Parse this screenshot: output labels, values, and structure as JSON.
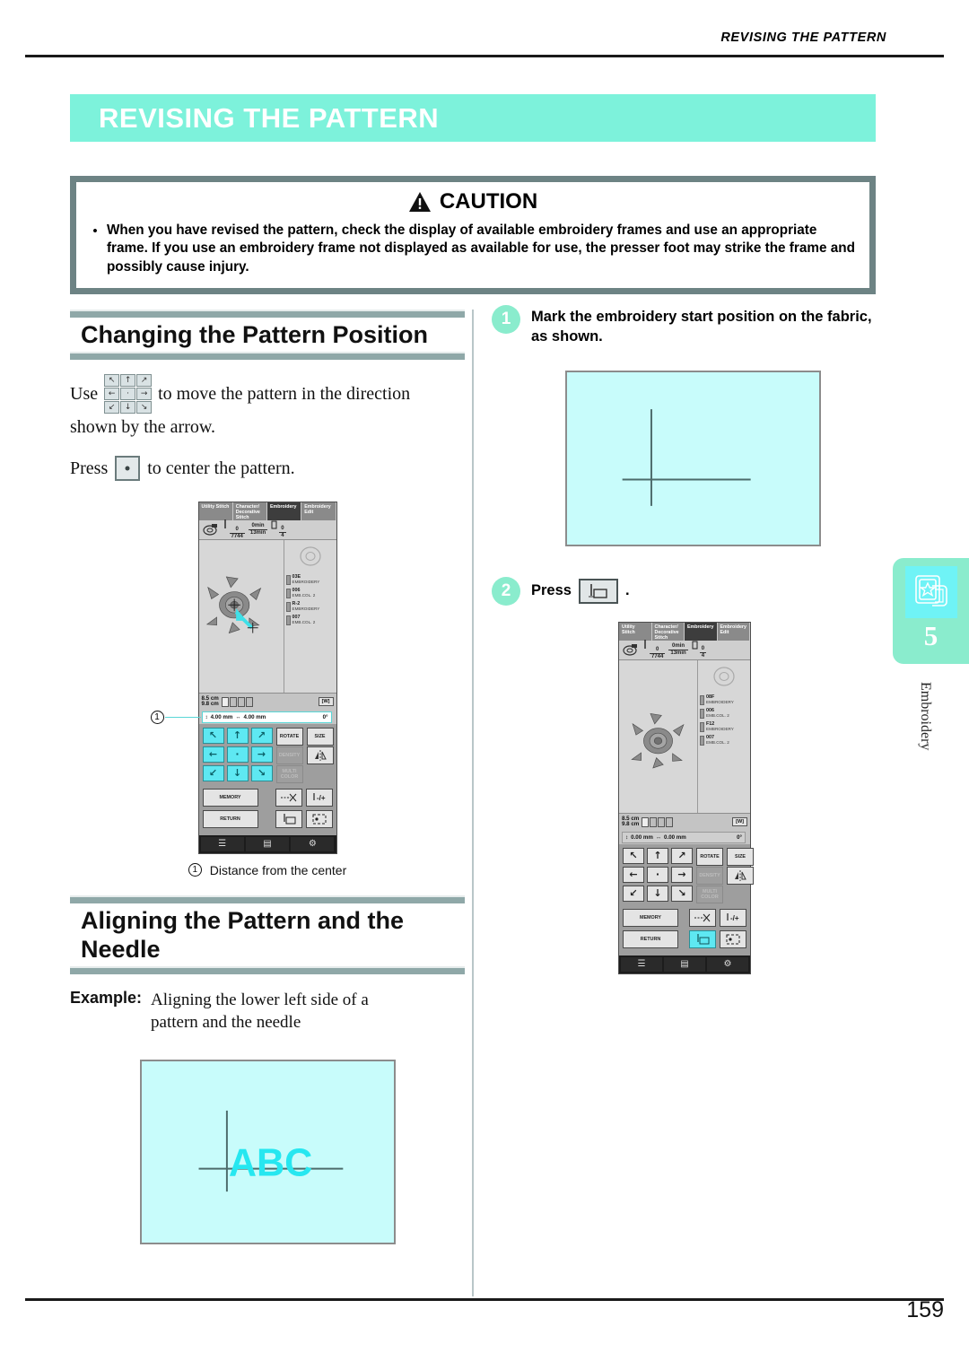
{
  "running_head": "REVISING THE PATTERN",
  "chapter_title": "REVISING THE PATTERN",
  "caution": {
    "heading": "CAUTION",
    "bullet": "•",
    "text": "When you have revised the pattern, check the display of available embroidery frames and use an appropriate frame. If you use an embroidery frame not displayed as available for use, the presser foot may strike the frame and possibly cause injury."
  },
  "left_column": {
    "section1_title": "Changing the Pattern Position",
    "use_prefix": "Use",
    "use_suffix": "to move the pattern in the direction",
    "use_line2": "shown by the arrow.",
    "press_prefix": "Press",
    "press_suffix": "to center the pattern.",
    "caption_number": "1",
    "caption_text": "Distance from the center",
    "section2_title_line1": "Aligning the Pattern and the",
    "section2_title_line2": "Needle",
    "example_label": "Example:",
    "example_text_line1": "Aligning the lower left side of a",
    "example_text_line2": "pattern and the needle",
    "abc_text": "ABC"
  },
  "right_column": {
    "step1_number": "1",
    "step1_text": "Mark the embroidery start position on the fabric, as shown.",
    "step2_number": "2",
    "step2_prefix": "Press",
    "step2_suffix": "."
  },
  "lcd_left": {
    "tabs": [
      {
        "label": "Utility Stitch",
        "active": false
      },
      {
        "label": "Character/ Decorative Stitch",
        "active": false
      },
      {
        "label": "Embroidery",
        "active": true
      },
      {
        "label": "Embroidery Edit",
        "active": false
      }
    ],
    "info": {
      "stitch_count_num": "0",
      "stitch_count_den": "7744",
      "time_num": "0min",
      "time_den": "13min",
      "color_num": "0",
      "color_den": "4"
    },
    "threads": [
      {
        "code": "03E",
        "brand": "EMBROIDERY"
      },
      {
        "code": "006",
        "brand": "EMB.COL. 2"
      },
      {
        "code": "R-2",
        "brand": "EMBROIDERY"
      },
      {
        "code": "007",
        "brand": "EMB.COL. 2"
      }
    ],
    "measure": {
      "size_w": "8.5 cm",
      "size_h": "9.8 cm",
      "offset_x": "4.00 mm",
      "offset_y": "4.00 mm",
      "angle": "0°"
    },
    "arrow_keys": [
      "↖",
      "↑",
      "↗",
      "←",
      "·",
      "→",
      "↙",
      "↓",
      "↘"
    ],
    "func_keys": {
      "rotate": "ROTATE",
      "size": "SIZE",
      "density": "DENSITY",
      "mirror": "mirror-icon",
      "multicolor": "MULTI COLOR",
      "memory": "MEMORY",
      "return": "RETURN",
      "trim": "trim-icon",
      "needle_updown": "needle-updown-icon",
      "start_position": "start-position-icon",
      "trial": "trial-icon"
    },
    "bottom_bar": [
      "🗎",
      "🖥",
      "🔧"
    ]
  },
  "lcd_right": {
    "tabs": [
      {
        "label": "Utility Stitch",
        "active": false
      },
      {
        "label": "Character/ Decorative Stitch",
        "active": false
      },
      {
        "label": "Embroidery",
        "active": true
      },
      {
        "label": "Embroidery Edit",
        "active": false
      }
    ],
    "info": {
      "stitch_count_num": "0",
      "stitch_count_den": "7744",
      "time_num": "0min",
      "time_den": "13min",
      "color_num": "0",
      "color_den": "4"
    },
    "threads": [
      {
        "code": "08F",
        "brand": "EMBROIDERY"
      },
      {
        "code": "006",
        "brand": "EMB.COL. 2"
      },
      {
        "code": "F12",
        "brand": "EMBROIDERY"
      },
      {
        "code": "007",
        "brand": "EMB.COL. 2"
      }
    ],
    "measure": {
      "size_w": "8.5 cm",
      "size_h": "9.8 cm",
      "offset_x": "0.00 mm",
      "offset_y": "0.00 mm",
      "angle": "0°"
    },
    "arrow_keys": [
      "↖",
      "↑",
      "↗",
      "←",
      "·",
      "→",
      "↙",
      "↓",
      "↘"
    ],
    "func_keys": {
      "rotate": "ROTATE",
      "size": "SIZE",
      "density": "DENSITY",
      "mirror": "mirror-icon",
      "multicolor": "MULTI COLOR",
      "memory": "MEMORY",
      "return": "RETURN",
      "trim": "trim-icon",
      "needle_updown": "needle-updown-icon",
      "start_position": "start-position-icon",
      "trial": "trial-icon"
    }
  },
  "side_tab": {
    "number": "5",
    "label": "Embroidery"
  },
  "page_number": "159",
  "colors": {
    "accent_mint": "#7df2db",
    "accent_badge": "#8aeccd",
    "rule_gray": "#8fa8a8",
    "caution_border": "#6d8384",
    "fabric_blue": "#c8fcfb",
    "lcd_cyan": "#5ee8f2"
  }
}
